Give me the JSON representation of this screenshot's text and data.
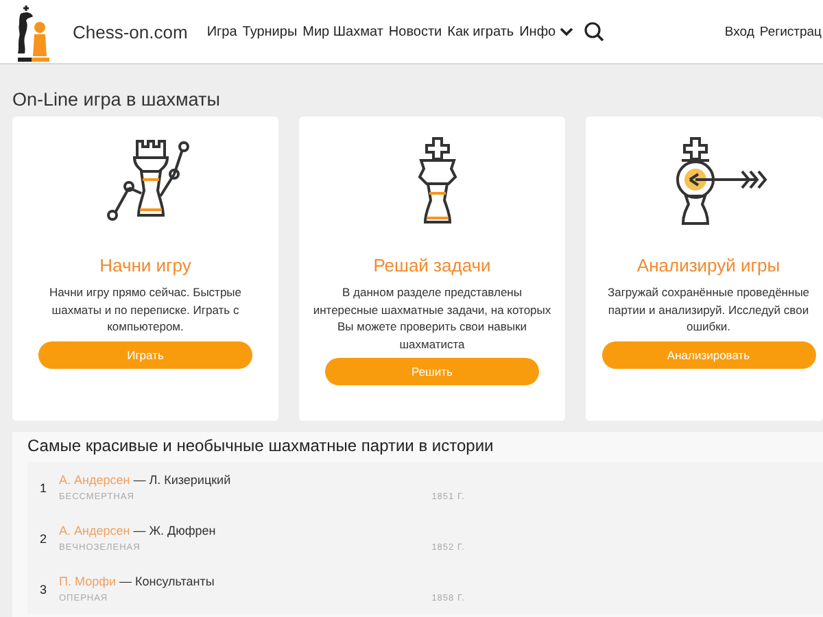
{
  "header": {
    "site_name": "Chess-on.com",
    "nav": [
      {
        "label": "Игра",
        "dropdown": false
      },
      {
        "label": "Турниры",
        "dropdown": false
      },
      {
        "label": "Мир Шахмат",
        "dropdown": false
      },
      {
        "label": "Новости",
        "dropdown": false
      },
      {
        "label": "Как играть",
        "dropdown": false
      },
      {
        "label": "Инфо",
        "dropdown": true
      }
    ],
    "auth": [
      "Вход",
      "Регистрац"
    ]
  },
  "section_title": "On-Line игра в шахматы",
  "cards": [
    {
      "kind": "rook",
      "title": "Начни игру",
      "text": "Начни игру прямо сейчас. Быстрые шахматы и по переписке. Играть с компьютером.",
      "button": "Играть"
    },
    {
      "kind": "king",
      "title": "Решай задачи",
      "text": "В данном разделе представлены интересные шахматные задачи, на которых Вы можете проверить свои навыки шахматиста",
      "button": "Решить"
    },
    {
      "kind": "target",
      "title": "Анализируй игры",
      "text": "Загружай сохранённые проведённые партии и анализируй. Исследуй свои ошибки.",
      "button": "Анализировать"
    }
  ],
  "games": {
    "title": "Самые красивые и необычные шахматные партии в истории",
    "rows": [
      {
        "number": "1",
        "white": "А. Андерсен",
        "dash": "—",
        "black": "Л. Кизерицкий",
        "name": "БЕССМЕРТНАЯ",
        "year": "1851 Г."
      },
      {
        "number": "2",
        "white": "А. Андерсен",
        "dash": "—",
        "black": "Ж. Дюфрен",
        "name": "ВЕЧНОЗЕЛЕНАЯ",
        "year": "1852 Г."
      },
      {
        "number": "3",
        "white": "П. Морфи",
        "dash": "—",
        "black": "Консультанты",
        "name": "ОПЕРНАЯ",
        "year": "1858 Г."
      }
    ]
  }
}
